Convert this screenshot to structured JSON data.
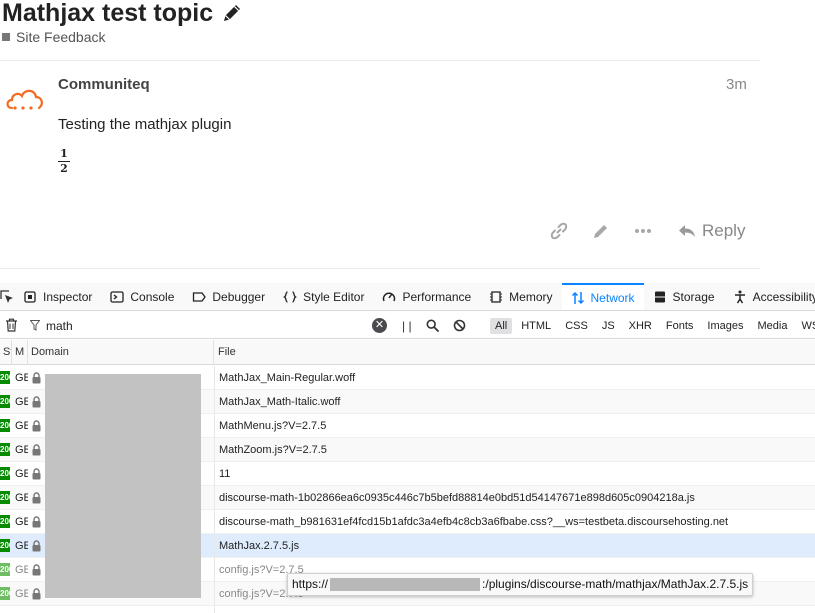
{
  "topic": {
    "title": "Mathjax test topic",
    "category": "Site Feedback"
  },
  "post": {
    "username": "Communiteq",
    "age": "3m",
    "body": "Testing the mathjax plugin",
    "fraction": {
      "numerator": "1",
      "denominator": "2"
    },
    "reply_label": "Reply"
  },
  "devtools": {
    "tabs": [
      {
        "label": "Inspector",
        "icon": "inspector-icon"
      },
      {
        "label": "Console",
        "icon": "console-icon"
      },
      {
        "label": "Debugger",
        "icon": "debugger-icon"
      },
      {
        "label": "Style Editor",
        "icon": "style-editor-icon"
      },
      {
        "label": "Performance",
        "icon": "performance-icon"
      },
      {
        "label": "Memory",
        "icon": "memory-icon"
      },
      {
        "label": "Network",
        "icon": "network-icon",
        "active": true
      },
      {
        "label": "Storage",
        "icon": "storage-icon"
      },
      {
        "label": "Accessibility",
        "icon": "accessibility-icon"
      }
    ],
    "filter_value": "math",
    "pause_label": "| |",
    "types": [
      "All",
      "HTML",
      "CSS",
      "JS",
      "XHR",
      "Fonts",
      "Images",
      "Media",
      "WS"
    ],
    "active_type": "All",
    "columns": {
      "status": "St",
      "method": "M",
      "domain": "Domain",
      "file": "File"
    },
    "rows": [
      {
        "status": "200",
        "method": "GET",
        "file": "MathJax_Main-Regular.woff"
      },
      {
        "status": "200",
        "method": "GET",
        "file": "MathJax_Math-Italic.woff"
      },
      {
        "status": "200",
        "method": "GET",
        "file": "MathMenu.js?V=2.7.5"
      },
      {
        "status": "200",
        "method": "GET",
        "file": "MathZoom.js?V=2.7.5"
      },
      {
        "status": "200",
        "method": "GET",
        "file": "11"
      },
      {
        "status": "200",
        "method": "GET",
        "file": "discourse-math-1b02866ea6c0935c446c7b5befd88814e0bd51d54147671e898d605c0904218a.js"
      },
      {
        "status": "200",
        "method": "GET",
        "file": "discourse-math_b981631ef4fcd15b1afdc3a4efb4c8cb3a6fbabe.css?__ws=testbeta.discoursehosting.net"
      },
      {
        "status": "200",
        "method": "GET",
        "file": "MathJax.2.7.5.js"
      },
      {
        "status": "200",
        "method": "GET",
        "file": "config.js?V=2.7.5"
      },
      {
        "status": "200",
        "method": "GET",
        "file": "config.js?V=2.7.5"
      }
    ],
    "tooltip": {
      "prefix": "https://",
      "suffix": ":/plugins/discourse-math/mathjax/MathJax.2.7.5.js"
    }
  }
}
